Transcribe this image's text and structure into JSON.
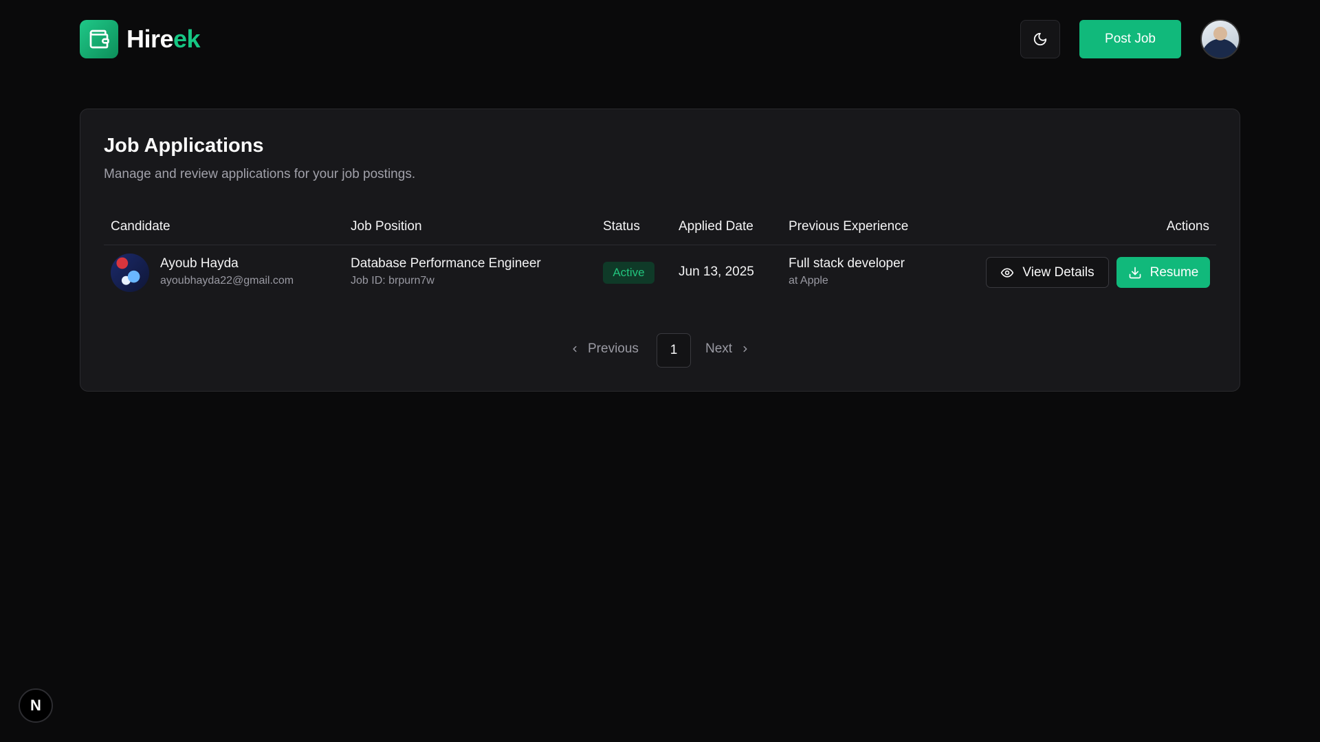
{
  "header": {
    "brand_prefix": "Hire",
    "brand_suffix": "ek",
    "post_job_label": "Post Job"
  },
  "card": {
    "title": "Job Applications",
    "subtitle": "Manage and review applications for your job postings."
  },
  "table": {
    "columns": [
      "Candidate",
      "Job Position",
      "Status",
      "Applied Date",
      "Previous Experience",
      "Actions"
    ],
    "rows": [
      {
        "candidate_name": "Ayoub Hayda",
        "candidate_email": "ayoubhayda22@gmail.com",
        "job_title": "Database Performance Engineer",
        "job_id": "Job ID: brpurn7w",
        "status": "Active",
        "applied_date": "Jun 13, 2025",
        "experience_title": "Full stack developer",
        "experience_company": "at Apple",
        "view_label": "View Details",
        "resume_label": "Resume"
      }
    ]
  },
  "pagination": {
    "previous_label": "Previous",
    "current_page": "1",
    "next_label": "Next"
  },
  "dev_badge": "N",
  "colors": {
    "accent": "#11b97b",
    "background": "#0a0a0b",
    "card": "#18181b",
    "status_active": "#22c47d"
  },
  "icons": [
    "wallet-icon",
    "moon-icon",
    "eye-icon",
    "download-icon",
    "chevron-left-icon",
    "chevron-right-icon"
  ]
}
